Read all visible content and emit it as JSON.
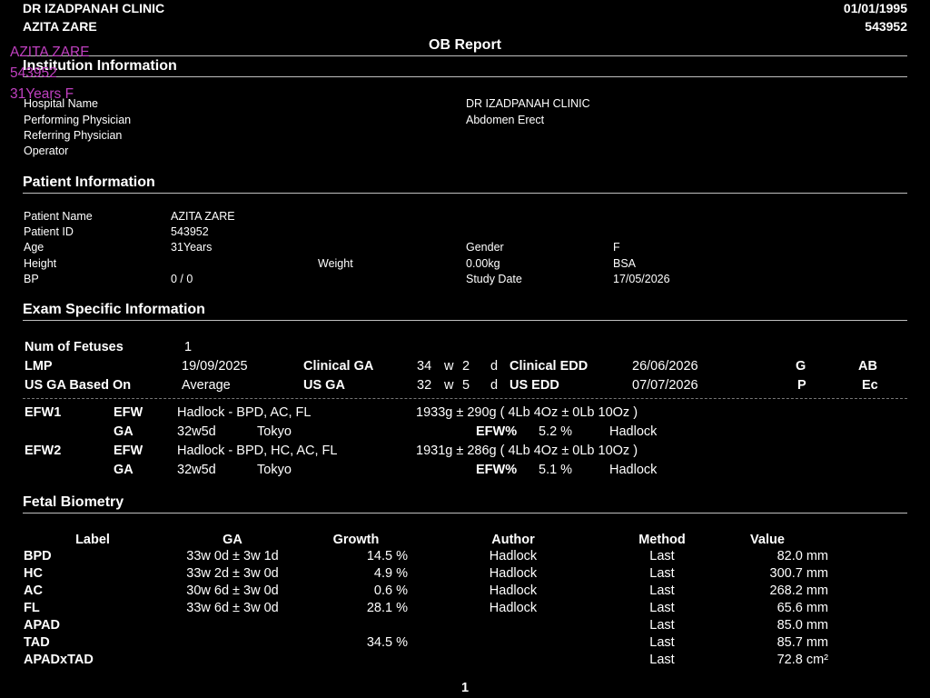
{
  "header": {
    "clinic": "DR IZADPANAH CLINIC",
    "patient": "AZITA ZARE",
    "date": "01/01/1995",
    "id": "543952",
    "title": "OB Report"
  },
  "overlay": {
    "name": "AZITA ZARE",
    "id": "543952",
    "age_gender": "31Years F"
  },
  "institution": {
    "title": "Institution Information",
    "hospital_label": "Hospital Name",
    "hospital_value": "DR IZADPANAH CLINIC",
    "performing_label": "Performing Physician",
    "performing_value": "Abdomen Erect",
    "referring_label": "Referring Physician",
    "operator_label": "Operator"
  },
  "patient": {
    "title": "Patient Information",
    "name_label": "Patient Name",
    "name_value": "AZITA ZARE",
    "id_label": "Patient ID",
    "id_value": "543952",
    "age_label": "Age",
    "age_value": "31Years",
    "gender_label": "Gender",
    "gender_value": "F",
    "height_label": "Height",
    "weight_label": "Weight",
    "weight_value": "0.00kg",
    "bsa_label": "BSA",
    "bp_label": "BP",
    "bp_value": "0 / 0",
    "study_label": "Study Date",
    "study_value": "17/05/2026"
  },
  "exam": {
    "title": "Exam Specific Information",
    "fetuses_label": "Num of Fetuses",
    "fetuses_value": "1",
    "lmp_label": "LMP",
    "lmp_value": "19/09/2025",
    "clinical_ga_label": "Clinical GA",
    "clinical_ga_w": "34",
    "clinical_ga_d": "2",
    "w": "w",
    "d": "d",
    "clinical_edd_label": "Clinical EDD",
    "clinical_edd_value": "26/06/2026",
    "g_label": "G",
    "ab_label": "AB",
    "us_ga_based_label": "US GA Based On",
    "us_ga_based_value": "Average",
    "us_ga_label": "US GA",
    "us_ga_w": "32",
    "us_ga_d": "5",
    "us_edd_label": "US EDD",
    "us_edd_value": "07/07/2026",
    "p_label": "P",
    "ec_label": "Ec",
    "efw": [
      {
        "name": "EFW1",
        "efw_label": "EFW",
        "method": "Hadlock - BPD, AC, FL",
        "weight": "1933g ± 290g ( 4Lb 4Oz ± 0Lb 10Oz )",
        "ga_label": "GA",
        "ga_value": "32w5d",
        "ga_author": "Tokyo",
        "pct_label": "EFW%",
        "pct_value": "5.2 %",
        "pct_author": "Hadlock"
      },
      {
        "name": "EFW2",
        "efw_label": "EFW",
        "method": "Hadlock - BPD, HC, AC, FL",
        "weight": "1931g ± 286g ( 4Lb 4Oz ± 0Lb 10Oz )",
        "ga_label": "GA",
        "ga_value": "32w5d",
        "ga_author": "Tokyo",
        "pct_label": "EFW%",
        "pct_value": "5.1 %",
        "pct_author": "Hadlock"
      }
    ]
  },
  "biometry": {
    "title": "Fetal Biometry",
    "columns": [
      "Label",
      "GA",
      "Growth",
      "Author",
      "Method",
      "Value"
    ],
    "rows": [
      [
        "BPD",
        "33w 0d ± 3w 1d",
        "14.5 %",
        "Hadlock",
        "Last",
        "82.0 mm"
      ],
      [
        "HC",
        "33w 2d ± 3w 0d",
        "4.9 %",
        "Hadlock",
        "Last",
        "300.7 mm"
      ],
      [
        "AC",
        "30w 6d ± 3w 0d",
        "0.6 %",
        "Hadlock",
        "Last",
        "268.2 mm"
      ],
      [
        "FL",
        "33w 6d ± 3w 0d",
        "28.1 %",
        "Hadlock",
        "Last",
        "65.6 mm"
      ],
      [
        "APAD",
        "",
        "",
        "",
        "Last",
        "85.0 mm"
      ],
      [
        "TAD",
        "",
        "34.5 %",
        "",
        "Last",
        "85.7 mm"
      ],
      [
        "APADxTAD",
        "",
        "",
        "",
        "Last",
        "72.8 cm²"
      ]
    ]
  },
  "footer": {
    "page": "1"
  }
}
